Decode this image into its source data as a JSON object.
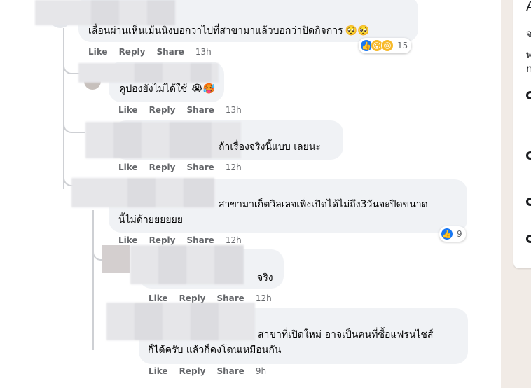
{
  "comments": [
    {
      "text": "เลื่อนผ่านเห็นเม้นนิงบอกว่าไปที่สาขามาแล้วบอกว่าปิดกิจการ",
      "emoji": "🥺🥺",
      "like": "Like",
      "reply": "Reply",
      "share": "Share",
      "time": "13h",
      "reaction_count": "15"
    },
    {
      "text": "คูปองยังไม่ได้ใช้",
      "emoji": "😭🥵",
      "like": "Like",
      "reply": "Reply",
      "share": "Share",
      "time": "13h"
    },
    {
      "text": "ถ้าเรื่องจริงนี้แบบ เลยนะ",
      "like": "Like",
      "reply": "Reply",
      "share": "Share",
      "time": "12h"
    },
    {
      "text_line1": "สาขามาเก็ตวิลเลจเพิ่งเปิดได้ไม่ถึง3วันจะปิดขนาด",
      "text_line2": "นี้ไม่ด้ายยยยยย",
      "like": "Like",
      "reply": "Reply",
      "share": "Share",
      "time": "12h",
      "reaction_count": "9"
    },
    {
      "text": "จริง",
      "like": "Like",
      "reply": "Reply",
      "share": "Share",
      "time": "12h"
    },
    {
      "text_line1": "สาขาที่เปิดใหม่ อาจเป็นคนที่ซื้อแฟรนไชส์",
      "text_line2": "ก็ได้ครับ แล้วก็คงโดนเหมือนกัน",
      "like": "Like",
      "reply": "Reply",
      "share": "Share",
      "time": "9h"
    }
  ],
  "side": {
    "letter_a": "A",
    "c1": "จ",
    "c2": "พ",
    "c3": "n"
  },
  "colors": {
    "accent": "#1877f2",
    "bubble": "#f0f2f5",
    "meta": "#65676b"
  }
}
